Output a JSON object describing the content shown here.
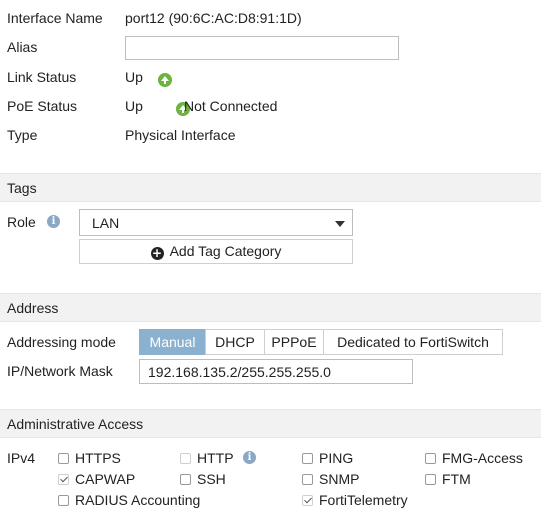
{
  "interface": {
    "name_label": "Interface Name",
    "name_value": "port12 (90:6C:AC:D8:91:1D)",
    "alias_label": "Alias",
    "alias_value": "",
    "link_status_label": "Link Status",
    "link_status_value": "Up",
    "poe_status_label": "PoE Status",
    "poe_status_value": "Up",
    "poe_extra": "Not Connected",
    "type_label": "Type",
    "type_value": "Physical Interface"
  },
  "tags": {
    "title": "Tags",
    "role_label": "Role",
    "role_value": "LAN",
    "add_tag_label": "Add Tag Category"
  },
  "address": {
    "title": "Address",
    "mode_label": "Addressing mode",
    "modes": [
      "Manual",
      "DHCP",
      "PPPoE",
      "Dedicated to FortiSwitch"
    ],
    "active_mode": "Manual",
    "ip_label": "IP/Network Mask",
    "ip_value": "192.168.135.2/255.255.255.0"
  },
  "admin_access": {
    "title": "Administrative Access",
    "ipv4_label": "IPv4",
    "options": [
      {
        "label": "HTTPS",
        "checked": false,
        "disabled": false
      },
      {
        "label": "HTTP",
        "checked": false,
        "disabled": true
      },
      {
        "label": "PING",
        "checked": false,
        "disabled": false
      },
      {
        "label": "FMG-Access",
        "checked": false,
        "disabled": false
      },
      {
        "label": "CAPWAP",
        "checked": true,
        "disabled": true
      },
      {
        "label": "SSH",
        "checked": false,
        "disabled": false
      },
      {
        "label": "SNMP",
        "checked": false,
        "disabled": false
      },
      {
        "label": "FTM",
        "checked": false,
        "disabled": false
      },
      {
        "label": "RADIUS Accounting",
        "checked": false,
        "disabled": false
      },
      {
        "label": "FortiTelemetry",
        "checked": true,
        "disabled": true
      }
    ]
  },
  "colors": {
    "accent": "#8ab1cf",
    "status_up": "#6cb33f",
    "section_bg": "#f2f2f2"
  }
}
